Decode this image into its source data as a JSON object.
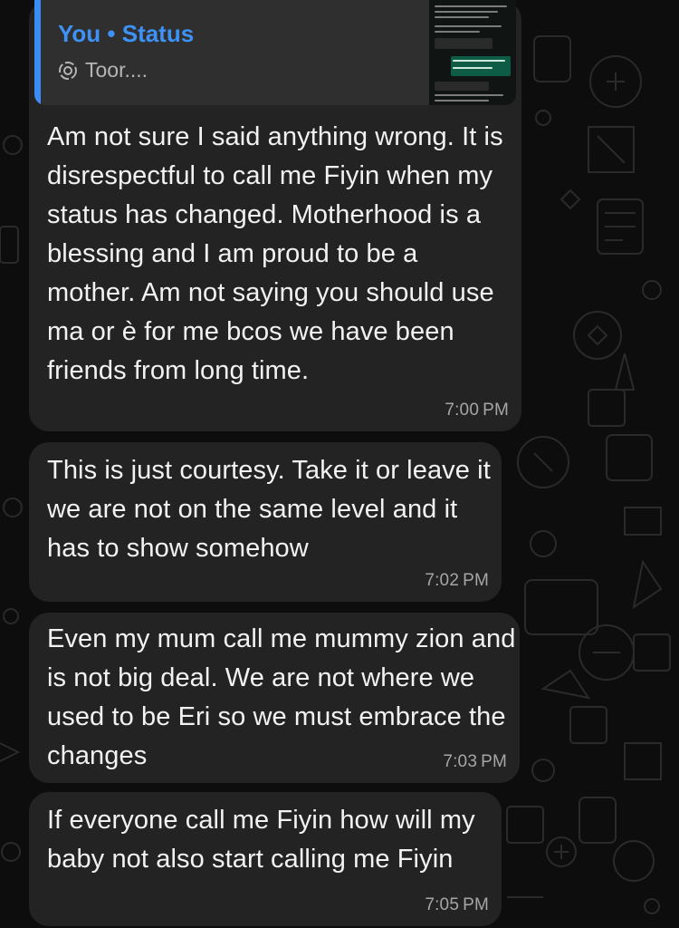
{
  "reply_preview": {
    "title": "You • Status",
    "subtitle": "Toor...."
  },
  "messages": [
    {
      "text": "Am not sure I said anything wrong. It is disrespectful to call me Fiyin when my status has changed. Motherhood is a blessing and I am proud to be a mother. Am not saying you should use ma or è for me bcos we have been friends from long time.",
      "time": "7:00 PM"
    },
    {
      "text": "This is just courtesy. Take it or leave it we are not on the same level and it has to show somehow",
      "time": "7:02 PM"
    },
    {
      "text": "Even my mum call me mummy zion and is not big deal. We are not where we used to be Eri so we must embrace the changes",
      "time": "7:03 PM"
    },
    {
      "text": "If everyone call me Fiyin how will my baby not also start calling me Fiyin",
      "time": "7:05 PM"
    }
  ],
  "colors": {
    "background": "#0d0d0d",
    "bubble": "#232323",
    "quote_accent": "#3c8cf6",
    "timestamp": "#a6a6a6",
    "text": "#f2f2f2"
  },
  "icons": {
    "status": "status-ring-icon"
  }
}
